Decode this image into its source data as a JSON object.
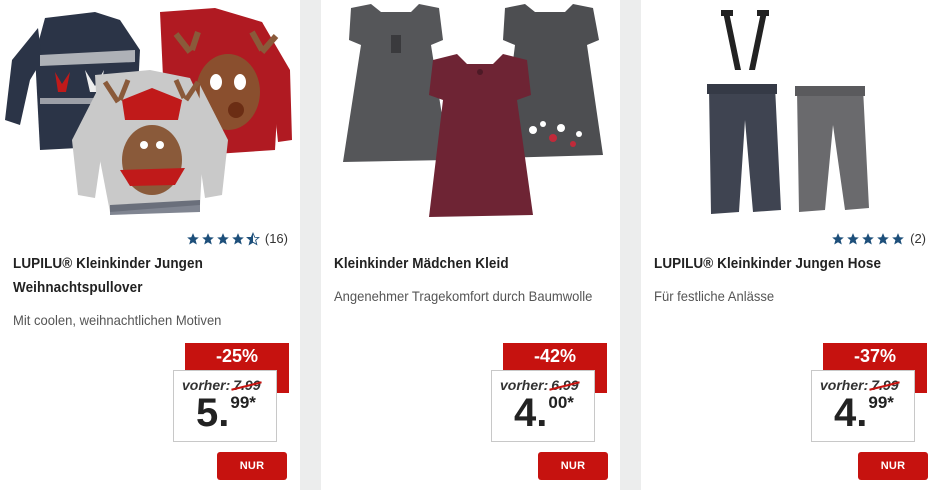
{
  "products": [
    {
      "title": "LUPILU® Kleinkinder Jungen Weihnachtspullover",
      "description": "Mit coolen, weihnachtlichen Motiven",
      "rating_stars": 4.5,
      "rating_count": "(16)",
      "discount": "-25%",
      "old_price_label": "vorher:",
      "old_price": "7.99",
      "price_int": "5.",
      "price_dec": "99*",
      "online_label": "NUR ONLINE",
      "image_icon": "sweaters-image"
    },
    {
      "title": "Kleinkinder Mädchen Kleid",
      "description": "Angenehmer Tragekomfort durch Baumwolle",
      "discount": "-42%",
      "old_price_label": "vorher:",
      "old_price": "6.99",
      "price_int": "4.",
      "price_dec": "00*",
      "online_label": "NUR ONLINE",
      "image_icon": "dresses-image"
    },
    {
      "title": "LUPILU® Kleinkinder Jungen Hose",
      "description": "Für festliche Anlässe",
      "rating_stars": 5,
      "rating_count": "(2)",
      "discount": "-37%",
      "old_price_label": "vorher:",
      "old_price": "7.99",
      "price_int": "4.",
      "price_dec": "99*",
      "online_label": "NUR ONLINE",
      "image_icon": "trousers-image"
    }
  ],
  "colors": {
    "accent_red": "#c6120f",
    "star_blue": "#1d4f7a",
    "page_bg": "#eceded"
  }
}
